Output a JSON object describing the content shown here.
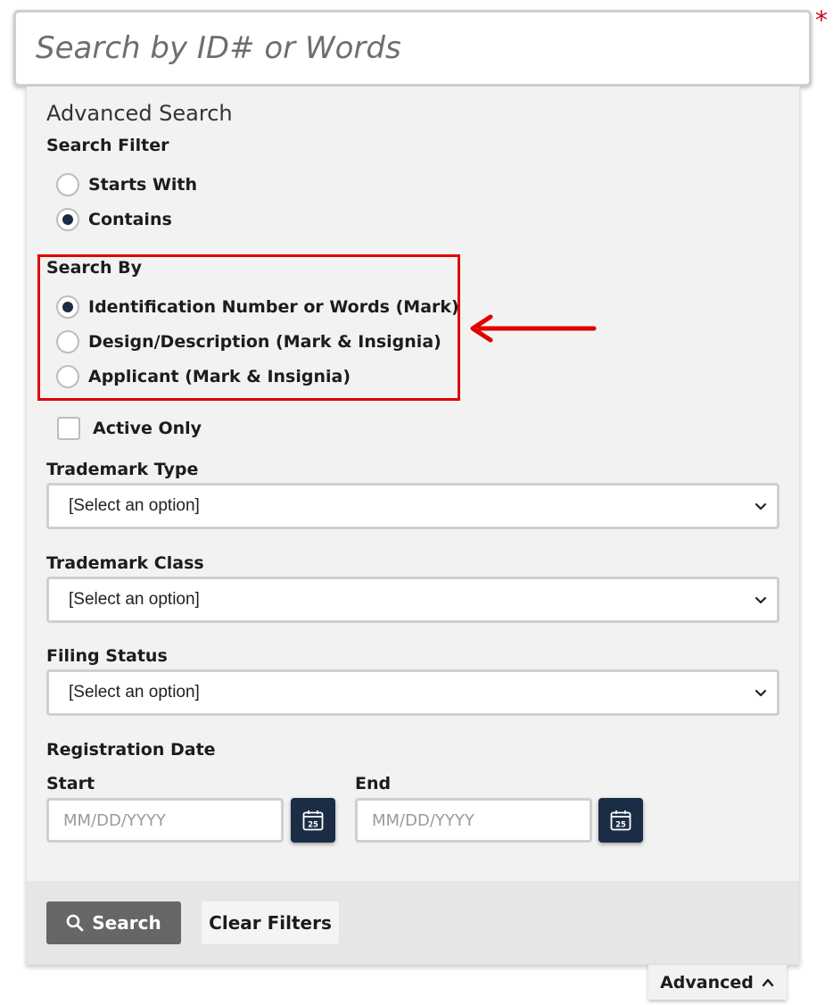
{
  "search": {
    "placeholder": "Search by ID# or Words",
    "required_marker": "*"
  },
  "advanced": {
    "title": "Advanced Search",
    "search_filter": {
      "label": "Search Filter",
      "options": [
        {
          "label": "Starts With",
          "checked": false
        },
        {
          "label": "Contains",
          "checked": true
        }
      ]
    },
    "search_by": {
      "label": "Search By",
      "options": [
        {
          "label": "Identification Number or Words (Mark)",
          "checked": true
        },
        {
          "label": "Design/Description (Mark & Insignia)",
          "checked": false
        },
        {
          "label": "Applicant (Mark & Insignia)",
          "checked": false
        }
      ]
    },
    "active_only": {
      "label": "Active Only",
      "checked": false
    },
    "trademark_type": {
      "label": "Trademark Type",
      "value": "[Select an option]"
    },
    "trademark_class": {
      "label": "Trademark Class",
      "value": "[Select an option]"
    },
    "filing_status": {
      "label": "Filing Status",
      "value": "[Select an option]"
    },
    "registration_date": {
      "label": "Registration Date",
      "start_label": "Start",
      "end_label": "End",
      "placeholder": "MM/DD/YYYY",
      "calendar_day": "25"
    },
    "buttons": {
      "search": "Search",
      "clear": "Clear Filters"
    },
    "toggle": "Advanced"
  },
  "colors": {
    "highlight": "#e00000",
    "navy": "#1b2d45",
    "search_button": "#666666"
  },
  "icons": {
    "search": "magnifier-icon",
    "calendar": "calendar-icon",
    "chevron": "chevron-down-icon",
    "toggle": "chevron-up-icon",
    "arrow": "arrow-left-icon"
  }
}
